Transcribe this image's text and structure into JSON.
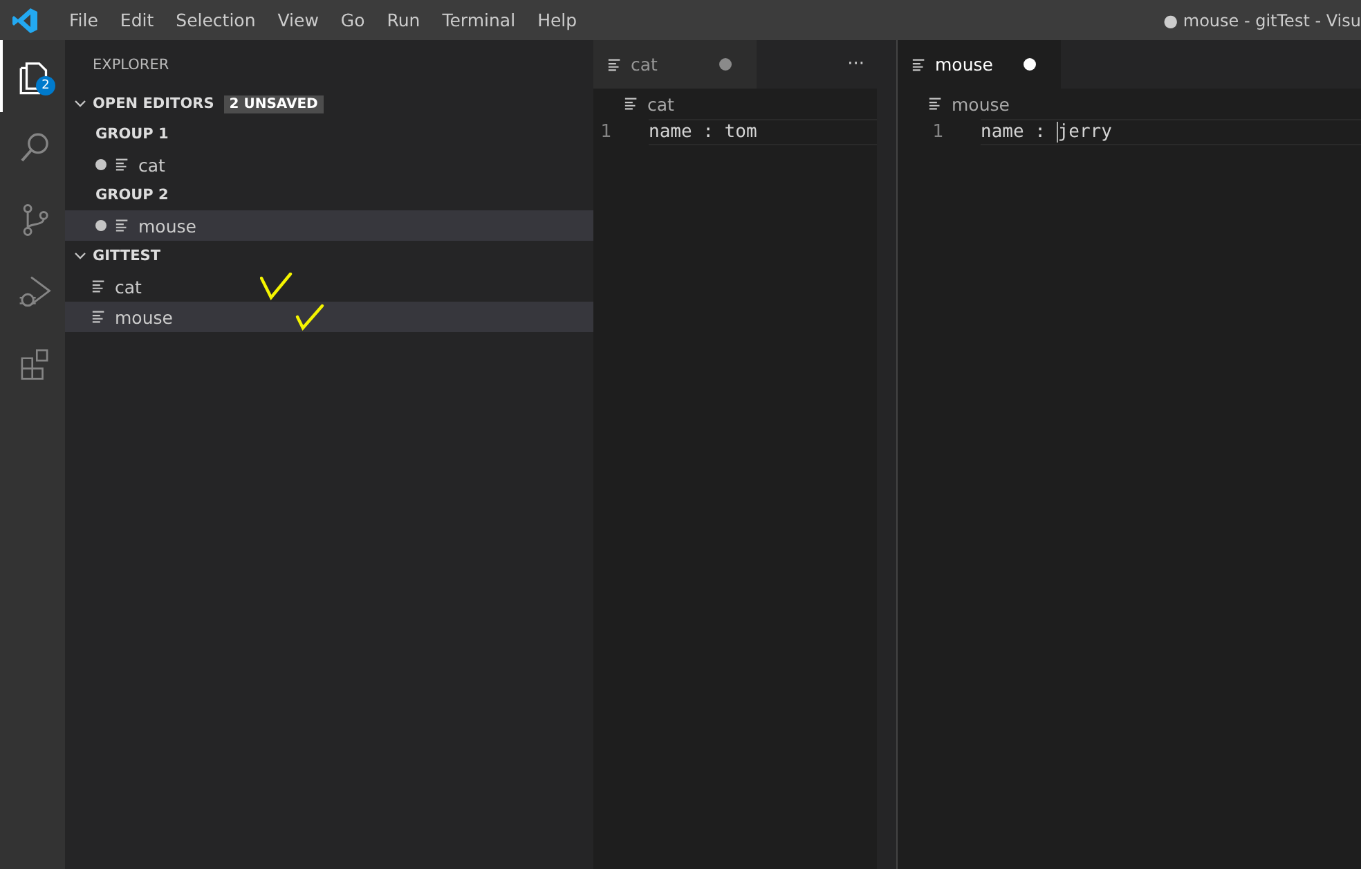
{
  "title_bar": {
    "menu": [
      "File",
      "Edit",
      "Selection",
      "View",
      "Go",
      "Run",
      "Terminal",
      "Help"
    ],
    "title": "● mouse - gitTest - Visu"
  },
  "activity_bar": [
    {
      "kind": "explorer",
      "selected": true,
      "badge": "2"
    },
    {
      "kind": "search",
      "selected": false
    },
    {
      "kind": "source-control",
      "selected": false
    },
    {
      "kind": "run-debug",
      "selected": false
    },
    {
      "kind": "extensions",
      "selected": false
    }
  ],
  "sidebar": {
    "title": "EXPLORER",
    "sections": [
      {
        "title": "OPEN EDITORS",
        "badge": "2 UNSAVED",
        "expanded": true,
        "groups": [
          {
            "title": "GROUP 1",
            "items": [
              {
                "label": "cat",
                "dirty": true,
                "selected": false
              }
            ]
          },
          {
            "title": "GROUP 2",
            "items": [
              {
                "label": "mouse",
                "dirty": true,
                "selected": true
              }
            ]
          }
        ]
      },
      {
        "title": "GITTEST",
        "expanded": true,
        "items": [
          {
            "label": "cat",
            "selected": false,
            "marked": true
          },
          {
            "label": "mouse",
            "selected": true,
            "marked": true
          }
        ]
      }
    ]
  },
  "editor_groups": [
    {
      "tabs": [
        {
          "label": "cat",
          "selected": false,
          "dirty": true
        }
      ],
      "more": "···",
      "breadcrumb": "cat",
      "lines": [
        {
          "number": "1",
          "text": "name : tom"
        }
      ]
    },
    {
      "tabs": [
        {
          "label": "mouse",
          "selected": true,
          "dirty": true
        }
      ],
      "breadcrumb": "mouse",
      "lines": [
        {
          "number": "1",
          "text_before_cursor": "name : ",
          "text_after_cursor": "jerry"
        }
      ]
    }
  ]
}
